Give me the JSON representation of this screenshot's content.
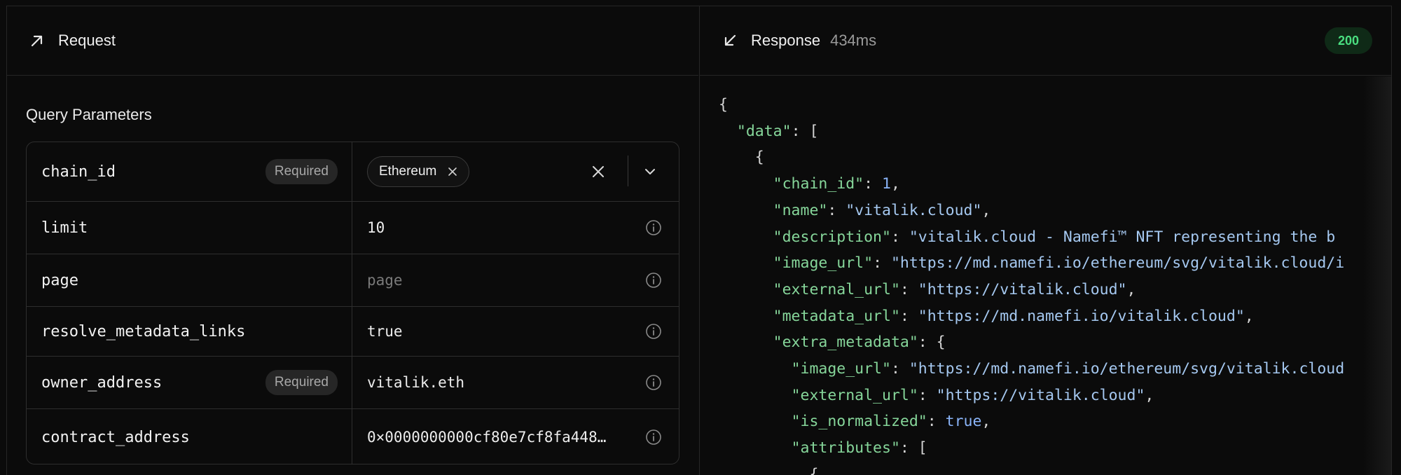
{
  "request": {
    "title": "Request",
    "icon": "arrow-up-right-icon",
    "section_title": "Query Parameters",
    "params": [
      {
        "name": "chain_id",
        "badge": "Required",
        "type": "select",
        "chip": "Ethereum"
      },
      {
        "name": "limit",
        "badge": "",
        "value": "10",
        "placeholder": ""
      },
      {
        "name": "page",
        "badge": "",
        "value": "",
        "placeholder": "page"
      },
      {
        "name": "resolve_metadata_links",
        "badge": "",
        "value": "true",
        "placeholder": ""
      },
      {
        "name": "owner_address",
        "badge": "Required",
        "value": "vitalik.eth",
        "placeholder": ""
      },
      {
        "name": "contract_address",
        "badge": "",
        "value": "0×0000000000cf80e7cf8fa448…",
        "placeholder": ""
      }
    ]
  },
  "response": {
    "title": "Response",
    "icon": "arrow-down-left-icon",
    "time": "434ms",
    "status": "200",
    "status_color": "#4ade80",
    "lines": [
      [
        {
          "t": "{",
          "c": "p"
        }
      ],
      [
        {
          "t": "  ",
          "c": "p"
        },
        {
          "t": "\"data\"",
          "c": "k"
        },
        {
          "t": ": [",
          "c": "p"
        }
      ],
      [
        {
          "t": "    {",
          "c": "p"
        }
      ],
      [
        {
          "t": "      ",
          "c": "p"
        },
        {
          "t": "\"chain_id\"",
          "c": "k"
        },
        {
          "t": ": ",
          "c": "p"
        },
        {
          "t": "1",
          "c": "n"
        },
        {
          "t": ",",
          "c": "p"
        }
      ],
      [
        {
          "t": "      ",
          "c": "p"
        },
        {
          "t": "\"name\"",
          "c": "k"
        },
        {
          "t": ": ",
          "c": "p"
        },
        {
          "t": "\"vitalik.cloud\"",
          "c": "s"
        },
        {
          "t": ",",
          "c": "p"
        }
      ],
      [
        {
          "t": "      ",
          "c": "p"
        },
        {
          "t": "\"description\"",
          "c": "k"
        },
        {
          "t": ": ",
          "c": "p"
        },
        {
          "t": "\"vitalik.cloud - Namefi™ NFT representing the b",
          "c": "s"
        }
      ],
      [
        {
          "t": "      ",
          "c": "p"
        },
        {
          "t": "\"image_url\"",
          "c": "k"
        },
        {
          "t": ": ",
          "c": "p"
        },
        {
          "t": "\"https://md.namefi.io/ethereum/svg/vitalik.cloud/i",
          "c": "s"
        }
      ],
      [
        {
          "t": "      ",
          "c": "p"
        },
        {
          "t": "\"external_url\"",
          "c": "k"
        },
        {
          "t": ": ",
          "c": "p"
        },
        {
          "t": "\"https://vitalik.cloud\"",
          "c": "s"
        },
        {
          "t": ",",
          "c": "p"
        }
      ],
      [
        {
          "t": "      ",
          "c": "p"
        },
        {
          "t": "\"metadata_url\"",
          "c": "k"
        },
        {
          "t": ": ",
          "c": "p"
        },
        {
          "t": "\"https://md.namefi.io/vitalik.cloud\"",
          "c": "s"
        },
        {
          "t": ",",
          "c": "p"
        }
      ],
      [
        {
          "t": "      ",
          "c": "p"
        },
        {
          "t": "\"extra_metadata\"",
          "c": "k"
        },
        {
          "t": ": {",
          "c": "p"
        }
      ],
      [
        {
          "t": "        ",
          "c": "p"
        },
        {
          "t": "\"image_url\"",
          "c": "k"
        },
        {
          "t": ": ",
          "c": "p"
        },
        {
          "t": "\"https://md.namefi.io/ethereum/svg/vitalik.cloud",
          "c": "s"
        }
      ],
      [
        {
          "t": "        ",
          "c": "p"
        },
        {
          "t": "\"external_url\"",
          "c": "k"
        },
        {
          "t": ": ",
          "c": "p"
        },
        {
          "t": "\"https://vitalik.cloud\"",
          "c": "s"
        },
        {
          "t": ",",
          "c": "p"
        }
      ],
      [
        {
          "t": "        ",
          "c": "p"
        },
        {
          "t": "\"is_normalized\"",
          "c": "k"
        },
        {
          "t": ": ",
          "c": "p"
        },
        {
          "t": "true",
          "c": "n"
        },
        {
          "t": ",",
          "c": "p"
        }
      ],
      [
        {
          "t": "        ",
          "c": "p"
        },
        {
          "t": "\"attributes\"",
          "c": "k"
        },
        {
          "t": ": [",
          "c": "p"
        }
      ],
      [
        {
          "t": "          {",
          "c": "p"
        }
      ]
    ]
  }
}
